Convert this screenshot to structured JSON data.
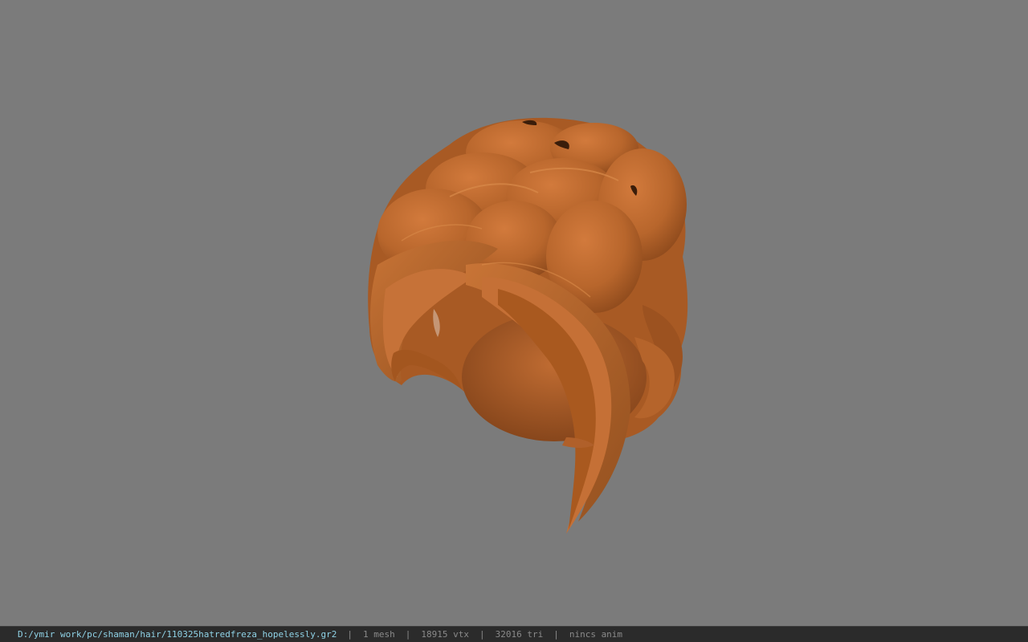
{
  "viewer": {
    "model_color": "#b8662c",
    "background_color": "#7b7b7b"
  },
  "status_bar": {
    "file_path": "D:/ymir work/pc/shaman/hair/110325hatredfreza_hopelessly.gr2",
    "separator": "|",
    "mesh_count": "1 mesh",
    "vertex_count": "18915 vtx",
    "triangle_count": "32016 tri",
    "anim_state": "nincs anim"
  }
}
